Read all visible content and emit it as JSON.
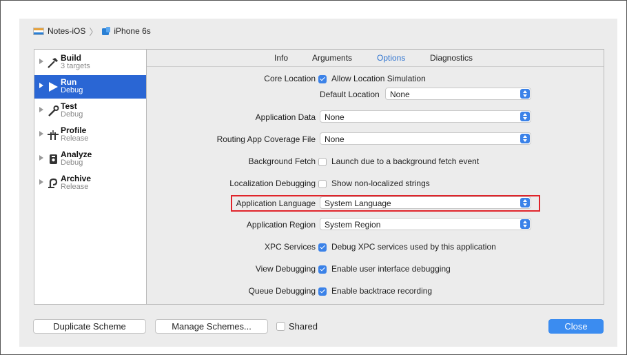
{
  "breadcrumb": {
    "project": "Notes-iOS",
    "device": "iPhone 6s"
  },
  "sidebar": {
    "items": [
      {
        "title": "Build",
        "subtitle": "3 targets",
        "icon": "hammer-icon"
      },
      {
        "title": "Run",
        "subtitle": "Debug",
        "icon": "play-icon",
        "selected": true
      },
      {
        "title": "Test",
        "subtitle": "Debug",
        "icon": "wrench-icon"
      },
      {
        "title": "Profile",
        "subtitle": "Release",
        "icon": "profile-icon"
      },
      {
        "title": "Analyze",
        "subtitle": "Debug",
        "icon": "analyze-icon"
      },
      {
        "title": "Archive",
        "subtitle": "Release",
        "icon": "archive-icon"
      }
    ]
  },
  "tabs": {
    "info": "Info",
    "arguments": "Arguments",
    "options": "Options",
    "diagnostics": "Diagnostics",
    "active": "Options"
  },
  "options": {
    "core_location": {
      "label": "Core Location",
      "checkbox": "Allow Location Simulation",
      "checked": true
    },
    "default_location": {
      "label": "Default Location",
      "value": "None"
    },
    "application_data": {
      "label": "Application Data",
      "value": "None"
    },
    "routing_file": {
      "label": "Routing App Coverage File",
      "value": "None"
    },
    "background_fetch": {
      "label": "Background Fetch",
      "checkbox": "Launch due to a background fetch event",
      "checked": false
    },
    "localization_debugging": {
      "label": "Localization Debugging",
      "checkbox": "Show non-localized strings",
      "checked": false
    },
    "application_language": {
      "label": "Application Language",
      "value": "System Language"
    },
    "application_region": {
      "label": "Application Region",
      "value": "System Region"
    },
    "xpc_services": {
      "label": "XPC Services",
      "checkbox": "Debug XPC services used by this application",
      "checked": true
    },
    "view_debugging": {
      "label": "View Debugging",
      "checkbox": "Enable user interface debugging",
      "checked": true
    },
    "queue_debugging": {
      "label": "Queue Debugging",
      "checkbox": "Enable backtrace recording",
      "checked": true
    }
  },
  "footer": {
    "duplicate": "Duplicate Scheme",
    "manage": "Manage Schemes...",
    "shared": "Shared",
    "close": "Close"
  },
  "colors": {
    "accent": "#3b82e8",
    "selection": "#2a66d4",
    "highlight": "#e0242a"
  }
}
